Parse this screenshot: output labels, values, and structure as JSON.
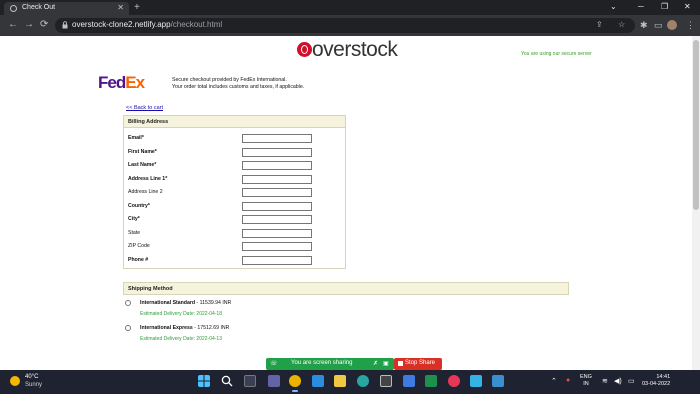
{
  "browser": {
    "tab_title": "Check Out",
    "tab_close": "✕",
    "new_tab": "+",
    "url_host": "overstock-clone2.netlify.app",
    "url_path": "/checkout.html",
    "win_min": "─",
    "win_max": "❐",
    "win_close": "✕",
    "nav_back": "←",
    "nav_forward": "→",
    "nav_reload": "⟳"
  },
  "header": {
    "logo_text": "overstock",
    "secure_text": "You are using our secure server"
  },
  "fedex": {
    "fed": "Fed",
    "ex": "Ex",
    "line1": "Secure checkout provided by FedEx International.",
    "line2": "Your order total includes customs and taxes, if applicable."
  },
  "back_link": "<< Back to cart",
  "billing": {
    "title": "Billing Address",
    "fields": [
      {
        "label": "Email*",
        "value": ""
      },
      {
        "label": "First Name*",
        "value": ""
      },
      {
        "label": "Last Name*",
        "value": ""
      },
      {
        "label": "Address Line 1*",
        "value": ""
      },
      {
        "label": "Address Line 2",
        "value": ""
      },
      {
        "label": "Country*",
        "value": ""
      },
      {
        "label": "City*",
        "value": ""
      },
      {
        "label": "State",
        "value": ""
      },
      {
        "label": "ZIP Code",
        "value": ""
      },
      {
        "label": "Phone #",
        "value": ""
      }
    ]
  },
  "shipping": {
    "title": "Shipping Method",
    "options": [
      {
        "name": "International Standard",
        "price": " - 11539.94 INR",
        "eta": "Estimated Delivery Date: 2022-04-18"
      },
      {
        "name": "International Express",
        "price": " - 17512.69 INR",
        "eta": "Estimated Delivery Date: 2022-04-13"
      }
    ]
  },
  "screen_share": {
    "text": "You are screen sharing",
    "stop": "Stop Share"
  },
  "taskbar": {
    "temp": "40°C",
    "weather": "Sunny",
    "lang1": "ENG",
    "lang2": "IN",
    "time": "14:41",
    "date": "03-04-2022"
  }
}
